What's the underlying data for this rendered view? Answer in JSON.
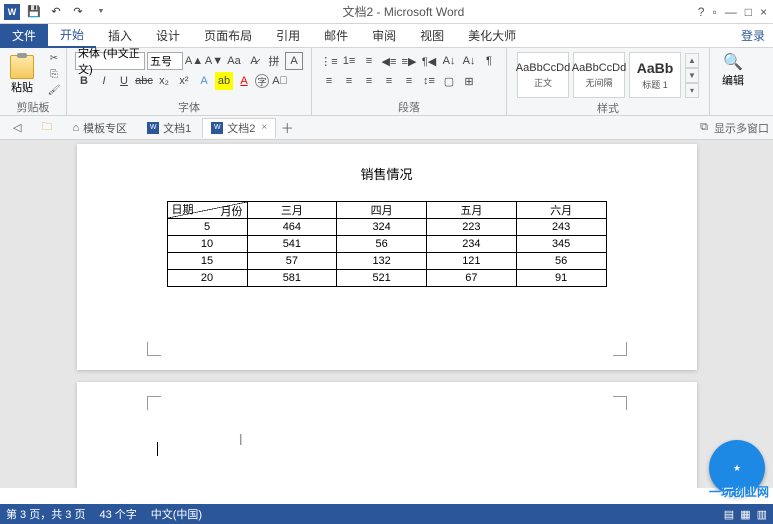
{
  "titlebar": {
    "title": "文档2 - Microsoft Word",
    "help": "?",
    "ribbon_opts": "▫",
    "minimize": "—",
    "maximize": "□",
    "close": "×"
  },
  "tabs": {
    "file": "文件",
    "home": "开始",
    "insert": "插入",
    "design": "设计",
    "layout": "页面布局",
    "references": "引用",
    "mail": "邮件",
    "review": "审阅",
    "view": "视图",
    "beauty": "美化大师",
    "login": "登录"
  },
  "ribbon": {
    "clipboard_label": "剪贴板",
    "paste": "粘贴",
    "font_label": "字体",
    "font_name": "宋体 (中文正文)",
    "font_size": "五号",
    "paragraph_label": "段落",
    "styles_label": "样式",
    "style1_preview": "AaBbCcDd",
    "style1_name": "正文",
    "style2_preview": "AaBbCcDd",
    "style2_name": "无间隔",
    "style3_preview": "AaBb",
    "style3_name": "标题 1",
    "editing_label": "编辑"
  },
  "doc_tabs": {
    "templates": "模板专区",
    "doc1": "文档1",
    "doc2": "文档2",
    "multi_window": "显示多窗口"
  },
  "document": {
    "title": "销售情况",
    "table": {
      "header_row_label": "日期",
      "header_col_label": "月份",
      "columns": [
        "三月",
        "四月",
        "五月",
        "六月"
      ],
      "rows": [
        {
          "label": "5",
          "cells": [
            "464",
            "324",
            "223",
            "243"
          ]
        },
        {
          "label": "10",
          "cells": [
            "541",
            "56",
            "234",
            "345"
          ]
        },
        {
          "label": "15",
          "cells": [
            "57",
            "132",
            "121",
            "56"
          ]
        },
        {
          "label": "20",
          "cells": [
            "581",
            "521",
            "67",
            "91"
          ]
        }
      ]
    }
  },
  "statusbar": {
    "page": "第 3 页，共 3 页",
    "words": "43 个字",
    "lang": "中文(中国)"
  },
  "watermark": "一玩创业网",
  "chart_data": {
    "type": "table",
    "title": "销售情况",
    "row_header": "日期",
    "col_header": "月份",
    "columns": [
      "三月",
      "四月",
      "五月",
      "六月"
    ],
    "rows": [
      "5",
      "10",
      "15",
      "20"
    ],
    "values": [
      [
        464,
        324,
        223,
        243
      ],
      [
        541,
        56,
        234,
        345
      ],
      [
        57,
        132,
        121,
        56
      ],
      [
        581,
        521,
        67,
        91
      ]
    ]
  }
}
